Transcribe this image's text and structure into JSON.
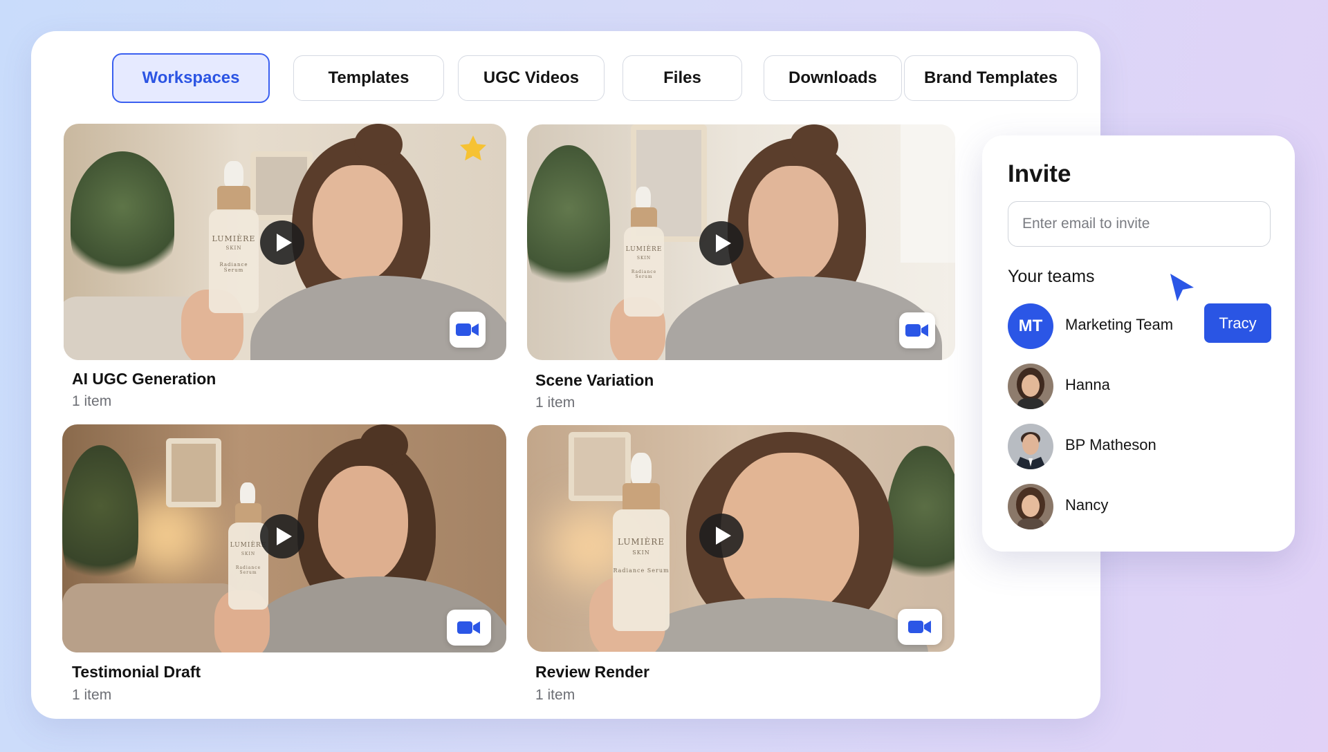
{
  "tabs": [
    {
      "label": "Workspaces",
      "active": true
    },
    {
      "label": "Templates",
      "active": false
    },
    {
      "label": "UGC Videos",
      "active": false
    },
    {
      "label": "Files",
      "active": false
    },
    {
      "label": "Downloads",
      "active": false
    },
    {
      "label": "Brand Templates",
      "active": false
    }
  ],
  "workspaces": [
    {
      "title": "AI UGC Generation",
      "count": "1 item",
      "starred": true
    },
    {
      "title": "Scene Variation",
      "count": "1 item",
      "starred": false
    },
    {
      "title": "Testimonial Draft",
      "count": "1 item",
      "starred": false
    },
    {
      "title": "Review Render",
      "count": "1 item",
      "starred": false
    }
  ],
  "product": {
    "brand": "LUMIÈRE",
    "line": "SKIN",
    "name": "Radiance Serum"
  },
  "invite": {
    "title": "Invite",
    "email_placeholder": "Enter email to invite",
    "teams_title": "Your teams",
    "members": [
      {
        "name": "Marketing Team",
        "initials": "MT",
        "action": "Tracy"
      },
      {
        "name": "Hanna",
        "initials": "",
        "action": ""
      },
      {
        "name": "BP Matheson",
        "initials": "",
        "action": ""
      },
      {
        "name": "Nancy",
        "initials": "",
        "action": ""
      }
    ]
  },
  "colors": {
    "accent": "#2b56e6",
    "active_tab_bg": "#e6eaff",
    "star": "#f6c233"
  },
  "icons": {
    "play": "play-icon",
    "camera": "video-camera-icon",
    "star": "star-icon",
    "cursor": "pointer-cursor-icon"
  }
}
